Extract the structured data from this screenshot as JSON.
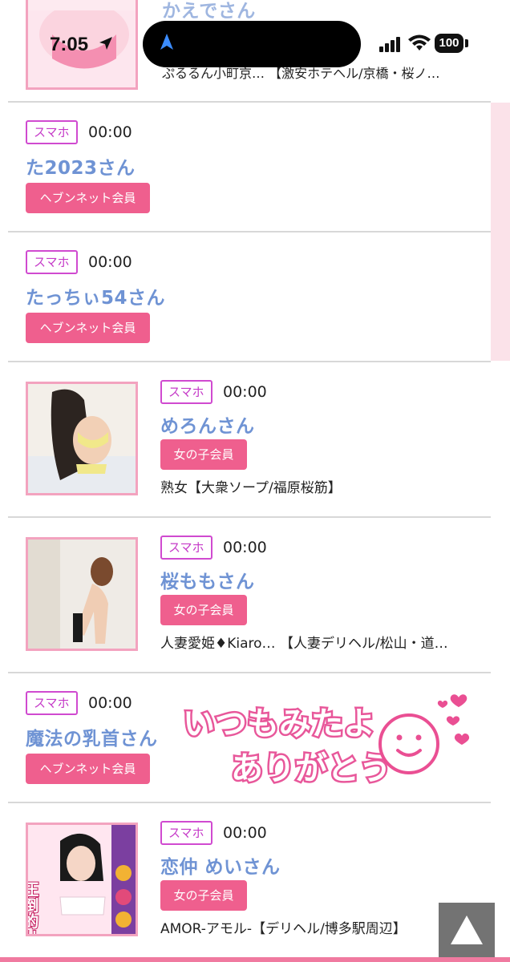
{
  "status": {
    "time": "7:05",
    "battery": "100"
  },
  "rows": [
    {
      "name": "かえでさん",
      "shop": "ぷるるん小町京… 【激安ホテヘル/京橋・桜ノ…"
    },
    {
      "device": "スマホ",
      "time": "00:00",
      "name": "た2023さん",
      "member": "ヘブンネット会員"
    },
    {
      "device": "スマホ",
      "time": "00:00",
      "name": "たっちぃ54さん",
      "member": "ヘブンネット会員"
    },
    {
      "device": "スマホ",
      "time": "00:00",
      "name": "めろんさん",
      "member": "女の子会員",
      "shop": "熟女【大衆ソープ/福原桜筋】"
    },
    {
      "device": "スマホ",
      "time": "00:00",
      "name": "桜ももさん",
      "member": "女の子会員",
      "shop": "人妻愛姫♦Kiaro… 【人妻デリヘル/松山・道…"
    },
    {
      "device": "スマホ",
      "time": "00:00",
      "name": "魔法の乳首さん",
      "member": "ヘブンネット会員",
      "stamp_line1": "いつもみたよ",
      "stamp_line2": "ありがとう"
    },
    {
      "device": "スマホ",
      "time": "00:00",
      "name": "恋仲 めいさん",
      "member": "女の子会員",
      "shop": "AMOR-アモル-【デリヘル/博多駅周辺】",
      "photo_text": "圧倒的リピート"
    }
  ],
  "scroll_top_icon": "triangle-up-icon",
  "colors": {
    "accent_pink": "#ef5f8e",
    "name_blue": "#6f93d4",
    "device_purple": "#c53ac8"
  }
}
